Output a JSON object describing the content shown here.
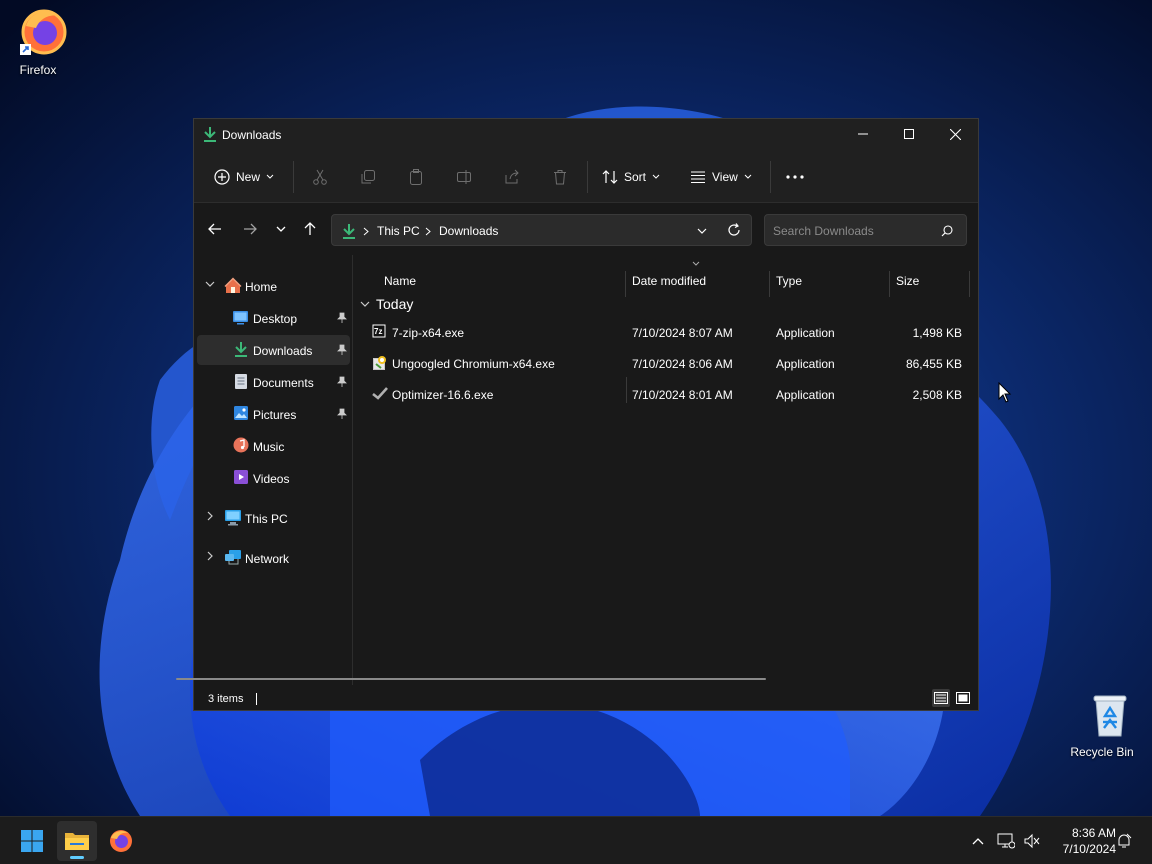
{
  "desktop": {
    "icons": [
      {
        "label": "Firefox"
      },
      {
        "label": "Recycle Bin"
      }
    ]
  },
  "window": {
    "title": "Downloads",
    "controls": {
      "minimize": "minimize",
      "maximize": "maximize",
      "close": "close"
    }
  },
  "command_bar": {
    "new_label": "New",
    "sort_label": "Sort",
    "view_label": "View",
    "disabled_actions": [
      "cut",
      "copy",
      "paste",
      "rename",
      "share",
      "delete"
    ]
  },
  "address": {
    "breadcrumbs": [
      "This PC",
      "Downloads"
    ],
    "search_placeholder": "Search Downloads"
  },
  "nav_pane": {
    "items": [
      {
        "label": "Home",
        "icon": "home-icon",
        "expanded": true
      },
      {
        "label": "Desktop",
        "icon": "desktop-folder-icon",
        "pinned": true
      },
      {
        "label": "Downloads",
        "icon": "download-icon",
        "pinned": true,
        "selected": true
      },
      {
        "label": "Documents",
        "icon": "documents-icon",
        "pinned": true
      },
      {
        "label": "Pictures",
        "icon": "pictures-icon",
        "pinned": true
      },
      {
        "label": "Music",
        "icon": "music-icon"
      },
      {
        "label": "Videos",
        "icon": "videos-icon"
      },
      {
        "label": "This PC",
        "icon": "this-pc-icon",
        "expanded": false
      },
      {
        "label": "Network",
        "icon": "network-icon",
        "expanded": false
      }
    ]
  },
  "file_list": {
    "columns": [
      "Name",
      "Date modified",
      "Type",
      "Size"
    ],
    "group": "Today",
    "rows": [
      {
        "name": "7-zip-x64.exe",
        "date": "7/10/2024 8:07 AM",
        "type": "Application",
        "size": "1,498 KB",
        "icon": "7zip-icon"
      },
      {
        "name": "Ungoogled Chromium-x64.exe",
        "date": "7/10/2024 8:06 AM",
        "type": "Application",
        "size": "86,455 KB",
        "icon": "installer-icon"
      },
      {
        "name": "Optimizer-16.6.exe",
        "date": "7/10/2024 8:01 AM",
        "type": "Application",
        "size": "2,508 KB",
        "icon": "checkmark-icon"
      }
    ]
  },
  "status_bar": {
    "item_count": "3 items"
  },
  "taskbar": {
    "clock_time": "8:36 AM",
    "clock_date": "7/10/2024"
  },
  "colors": {
    "accent": "#60cdff",
    "download_green": "#3cb878",
    "window_bg": "#191919",
    "toolbar_bg": "#202020"
  }
}
